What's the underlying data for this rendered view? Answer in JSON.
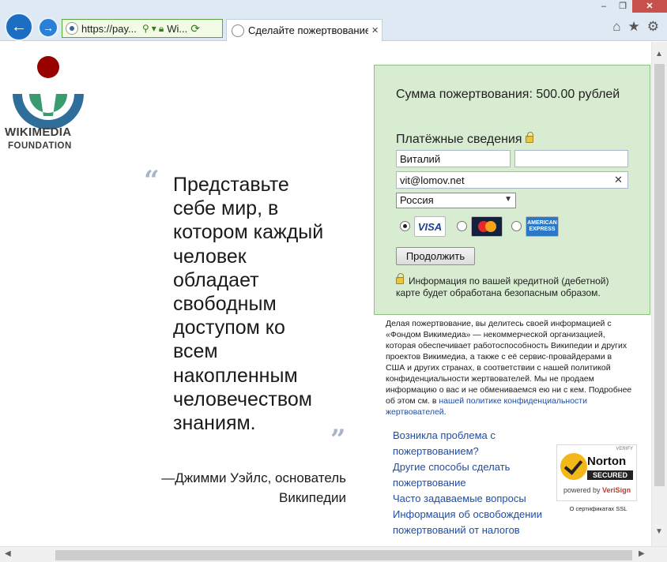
{
  "browser": {
    "url_text": "https://pay...",
    "site_label": "Wi...",
    "tab_title": "Сделайте пожертвование ...",
    "window_controls": [
      "minimize",
      "maximize",
      "close"
    ],
    "toolbar_icons": [
      "home-icon",
      "favorites-star-icon",
      "settings-gear-icon"
    ]
  },
  "logo": {
    "name": "WIKIMEDIA",
    "sub": "FOUNDATION"
  },
  "quote": {
    "text": "Представьте себе мир, в котором каждый человек обладает свободным доступом ко всем накопленным человечеством знаниям.",
    "attribution": "—Джимми Уэйлс, основатель Википедии"
  },
  "form": {
    "amount_label": "Сумма пожертвования: 500.00 рублей",
    "payment_title": "Платёжные сведения",
    "first_name": "Виталий",
    "last_name": "",
    "email": "vit@lomov.net",
    "country": "Россия",
    "cards": {
      "visa": "VISA",
      "mastercard": "MasterCard",
      "amex": "AMERICAN EXPRESS"
    },
    "selected_card": "visa",
    "continue_label": "Продолжить",
    "secure_note": "Информация по вашей кредитной (дебетной) карте будет обработана безопасным образом."
  },
  "privacy": {
    "text": "Делая пожертвование, вы делитесь своей информацией с «Фондом Викимедиа» — некоммерческой организацией, которая обеспечивает работоспособность Википедии и других проектов Викимедиа, а также с её сервис-провайдерами в США и других странах, в соответствии с нашей политикой конфиденциальности жертвователей. Мы не продаем информацию о вас и не обмениваемся ею ни с кем. Подробнее об этом см. в ",
    "link": "нашей политике конфиденциальности жертвователей",
    "end": "."
  },
  "help_links": [
    "Возникла проблема с пожертвованием?",
    "Другие способы сделать пожертвование",
    "Часто задаваемые вопросы",
    "Информация об освобождении пожертвований от налогов"
  ],
  "norton": {
    "verify": "VERIFY",
    "name": "Norton",
    "secured": "SECURED",
    "powered": "powered by",
    "verisign": "VeriSign",
    "ssl": "О сертификатах SSL"
  }
}
